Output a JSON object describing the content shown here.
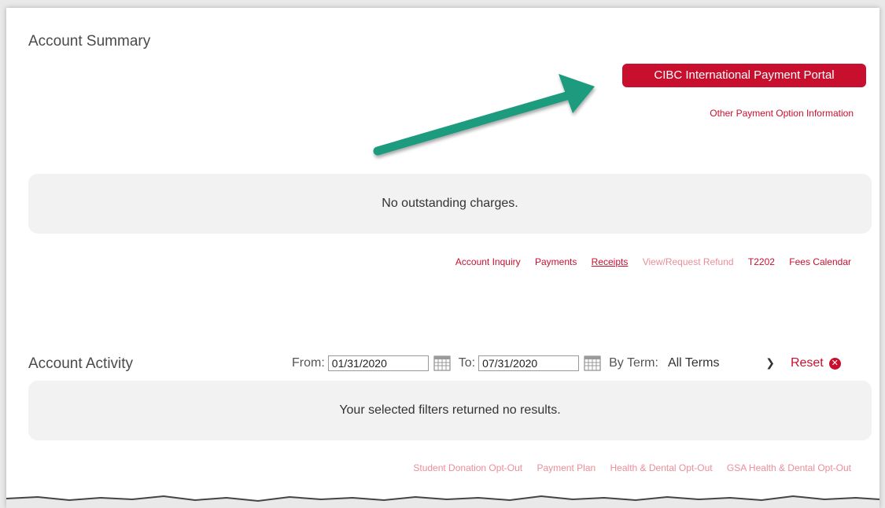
{
  "summary": {
    "title": "Account Summary",
    "portal_button": "CIBC International Payment Portal",
    "other_payment_link": "Other Payment Option Information",
    "outstanding_message": "No outstanding charges.",
    "links": [
      {
        "label": "Account Inquiry",
        "state": "active"
      },
      {
        "label": "Payments",
        "state": "active"
      },
      {
        "label": "Receipts",
        "state": "active-underlined"
      },
      {
        "label": "View/Request Refund",
        "state": "disabled"
      },
      {
        "label": "T2202",
        "state": "active"
      },
      {
        "label": "Fees Calendar",
        "state": "active"
      }
    ]
  },
  "activity": {
    "title": "Account Activity",
    "from_label": "From:",
    "from_value": "01/31/2020",
    "to_label": "To:",
    "to_value": "07/31/2020",
    "term_label": "By Term:",
    "term_value": "All Terms",
    "reset_label": "Reset",
    "no_results_message": "Your selected filters returned no results.",
    "links": [
      {
        "label": "Student Donation Opt-Out"
      },
      {
        "label": "Payment Plan"
      },
      {
        "label": "Health & Dental Opt-Out"
      },
      {
        "label": "GSA Health & Dental Opt-Out"
      }
    ]
  },
  "icons": {
    "calendar": "calendar-icon",
    "chevron": "chevron-down-icon",
    "reset": "close-circle-icon",
    "annotation": "annotation-arrow"
  },
  "colors": {
    "brand_red": "#c8102e",
    "disabled_link": "#ec8d99",
    "annotation_arrow": "#1a9b7f",
    "panel_bg": "#f2f2f2"
  }
}
